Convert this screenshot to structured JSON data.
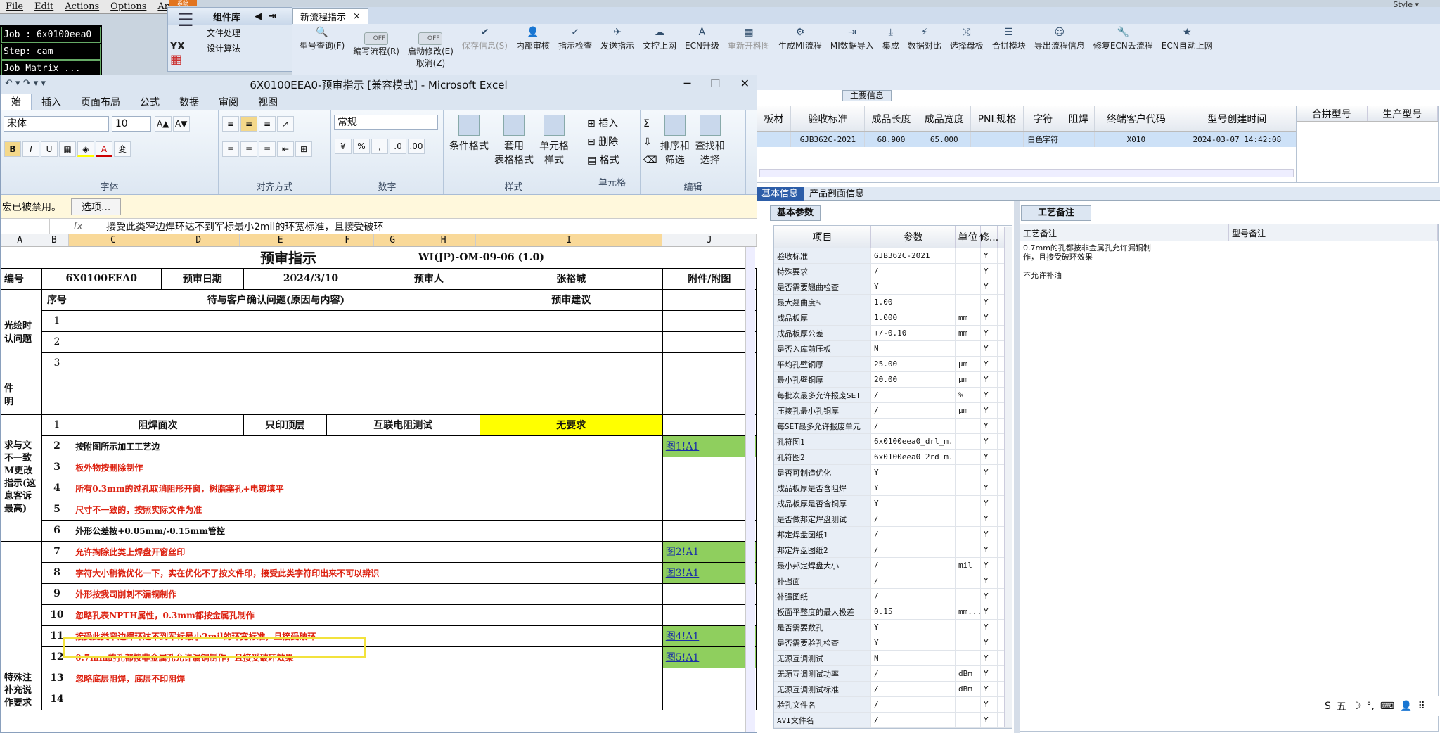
{
  "legacy": {
    "menu": [
      "File",
      "Edit",
      "Actions",
      "Options",
      "Ar"
    ],
    "job": "Job : 6x0100eea0",
    "step": "Step: cam",
    "matrix": "Job Matrix ...",
    "orange": "系统"
  },
  "style_label": "Style ▾",
  "complib": {
    "title": "组件库",
    "items": [
      "文件处理",
      "设计算法"
    ],
    "logo": "YX"
  },
  "ribbon": {
    "tab": "新流程指示",
    "tools": [
      {
        "label": "型号查询(F)",
        "icon": "🔍",
        "dis": false
      },
      {
        "label": "编写流程(R)",
        "icon": "OFF",
        "dis": false,
        "toggle": true
      },
      {
        "label": "启动修改(E)",
        "icon": "OFF",
        "dis": false,
        "toggle": true
      },
      {
        "label": "保存信息(S)",
        "icon": "✔",
        "dis": true
      },
      {
        "label": "内部审核",
        "icon": "👤",
        "dis": false
      },
      {
        "label": "指示检查",
        "icon": "✓",
        "dis": false
      },
      {
        "label": "发送指示",
        "icon": "✈",
        "dis": false
      },
      {
        "label": "文控上网",
        "icon": "☁",
        "dis": false
      },
      {
        "label": "ECN升级",
        "icon": "A",
        "dis": false
      },
      {
        "label": "重新开料图",
        "icon": "▦",
        "dis": true
      },
      {
        "label": "生成MI流程",
        "icon": "⚙",
        "dis": false
      },
      {
        "label": "MI数据导入",
        "icon": "⇥",
        "dis": false
      },
      {
        "label": "集成",
        "icon": "⤓",
        "dis": false
      },
      {
        "label": "数据对比",
        "icon": "⚡",
        "dis": false
      },
      {
        "label": "选择母板",
        "icon": "⤮",
        "dis": false
      },
      {
        "label": "合拼模块",
        "icon": "☰",
        "dis": false
      },
      {
        "label": "导出流程信息",
        "icon": "☺",
        "dis": false
      },
      {
        "label": "修复ECN丢流程",
        "icon": "🔧",
        "dis": false
      },
      {
        "label": "ECN自动上网",
        "icon": "★",
        "dis": false
      }
    ],
    "sub": "取消(Z)"
  },
  "main_info": "主要信息",
  "main_grid": {
    "headers": [
      "板材",
      "验收标准",
      "成品长度",
      "成品宽度",
      "PNL规格",
      "字符",
      "阻焊",
      "终端客户代码",
      "型号创建时间"
    ],
    "row": [
      "",
      "GJB362C-2021",
      "68.900",
      "65.000",
      "",
      "白色字符",
      "",
      "X010",
      "2024-03-07 14:42:08"
    ]
  },
  "grid2_headers": [
    "合拼型号",
    "生产型号"
  ],
  "info_tabs": [
    "基本信息",
    "产品剖面信息"
  ],
  "basic_tab": "基本参数",
  "craft_tab": "工艺备注",
  "param_headers": [
    "项目",
    "参数",
    "单位",
    "修..."
  ],
  "params": [
    [
      "验收标准",
      "GJB362C-2021",
      "",
      "Y"
    ],
    [
      "特殊要求",
      "/",
      "",
      "Y"
    ],
    [
      "是否需要翘曲检查",
      "Y",
      "",
      "Y"
    ],
    [
      "最大翘曲度%",
      "1.00",
      "",
      "Y"
    ],
    [
      "成品板厚",
      "1.000",
      "mm",
      "Y"
    ],
    [
      "成品板厚公差",
      "+/-0.10",
      "mm",
      "Y"
    ],
    [
      "是否入库前压板",
      "N",
      "",
      "Y"
    ],
    [
      "平均孔壁铜厚",
      "25.00",
      "μm",
      "Y"
    ],
    [
      "最小孔壁铜厚",
      "20.00",
      "μm",
      "Y"
    ],
    [
      "每批次最多允许报废SET",
      "/",
      "%",
      "Y"
    ],
    [
      "压接孔最小孔铜厚",
      "/",
      "μm",
      "Y"
    ],
    [
      "每SET最多允许报废单元",
      "/",
      "",
      "Y"
    ],
    [
      "孔符图1",
      "6x0100eea0_drl_m...",
      "",
      "Y"
    ],
    [
      "孔符图2",
      "6x0100eea0_2rd_m...",
      "",
      "Y"
    ],
    [
      "是否可制造优化",
      "Y",
      "",
      "Y"
    ],
    [
      "成品板厚是否含阻焊",
      "Y",
      "",
      "Y"
    ],
    [
      "成品板厚是否含铜厚",
      "Y",
      "",
      "Y"
    ],
    [
      "是否做邦定焊盘测试",
      "/",
      "",
      "Y"
    ],
    [
      "邦定焊盘图纸1",
      "/",
      "",
      "Y"
    ],
    [
      "邦定焊盘图纸2",
      "/",
      "",
      "Y"
    ],
    [
      "最小邦定焊盘大小",
      "/",
      "mil",
      "Y"
    ],
    [
      "补强面",
      "/",
      "",
      "Y"
    ],
    [
      "补强图纸",
      "/",
      "",
      "Y"
    ],
    [
      "板面平整度的最大极差",
      "0.15",
      "mm...",
      "Y"
    ],
    [
      "是否需要数孔",
      "Y",
      "",
      "Y"
    ],
    [
      "是否需要验孔检查",
      "Y",
      "",
      "Y"
    ],
    [
      "无源互调测试",
      "N",
      "",
      "Y"
    ],
    [
      "无源互调测试功率",
      "/",
      "dBm",
      "Y"
    ],
    [
      "无源互调测试标准",
      "/",
      "dBm",
      "Y"
    ],
    [
      "验孔文件名",
      "/",
      "",
      "Y"
    ],
    [
      "AVI文件名",
      "/",
      "",
      "Y"
    ]
  ],
  "craft_headers": [
    "工艺备注",
    "型号备注"
  ],
  "craft_note": [
    "0.7mm的孔都按非金属孔允许漏铜制作，且接受破环效果",
    "",
    "不允许补油"
  ],
  "excel": {
    "title": "6X0100EEA0-预审指示  [兼容模式] - Microsoft Excel",
    "tabs": [
      "始",
      "插入",
      "页面布局",
      "公式",
      "数据",
      "审阅",
      "视图"
    ],
    "font": "宋体",
    "size": "10",
    "numfmt": "常规",
    "groups": [
      "字体",
      "对齐方式",
      "数字",
      "样式",
      "单元格",
      "编辑"
    ],
    "style_btns": [
      "条件格式",
      "套用\n表格格式",
      "单元格\n样式"
    ],
    "cell_btns": [
      "插入",
      "删除",
      "格式"
    ],
    "edit_btns": [
      "排序和\n筛选",
      "查找和\n选择"
    ],
    "macro_msg": "宏已被禁用。",
    "macro_btn": "选项...",
    "formula": "接受此类窄边焊环达不到军标最小2mil的环宽标准，且接受破环",
    "cols": [
      "A",
      "B",
      "C",
      "D",
      "E",
      "F",
      "G",
      "H",
      "I",
      "J"
    ]
  },
  "sheet": {
    "title": "预审指示",
    "docno": "WI(JP)-OM-09-06 (1.0)",
    "r_code_label": "编号",
    "r_code": "6X0100EEA0",
    "r_date_label": "预审日期",
    "r_date": "2024/3/10",
    "r_person_label": "预审人",
    "r_person": "张裕城",
    "r_attach": "附件/附图",
    "h_seq": "序号",
    "h_issue": "待与客户确认问题(原因与内容)",
    "h_sugg": "预审建议",
    "grp1": "光绘时\n认问题",
    "grp2": "件\n明",
    "grp3": "求与文\n不一致\nM更改\n指示(这\n息客诉\n最高)",
    "grp4": "特殊注\n补充说\n作要求",
    "row1": [
      "阻焊面次",
      "只印顶层",
      "互联电阻测试",
      "无要求"
    ],
    "items": [
      {
        "n": "2",
        "t": "按附图所示加工工艺边",
        "red": false,
        "a": "图1!A1"
      },
      {
        "n": "3",
        "t": "板外物按删除制作",
        "red": true,
        "a": ""
      },
      {
        "n": "4",
        "t": "所有0.3mm的过孔取消阻形开窗，树脂塞孔+电镀填平",
        "red": true,
        "a": ""
      },
      {
        "n": "5",
        "t": "尺寸不一致的，按照实际文件为准",
        "red": true,
        "a": ""
      },
      {
        "n": "6",
        "t": "外形公差按+0.05mm/-0.15mm管控",
        "red": false,
        "a": ""
      },
      {
        "n": "7",
        "t": "允许掏除此类上焊盘开窗丝印",
        "red": true,
        "a": "图2!A1"
      },
      {
        "n": "8",
        "t": "字符大小稍微优化一下，实在优化不了按文件印，接受此类字符印出来不可以辨识",
        "red": true,
        "a": "图3!A1"
      },
      {
        "n": "9",
        "t": "外形按我司削刺不漏铜制作",
        "red": true,
        "a": ""
      },
      {
        "n": "10",
        "t": "忽略孔表NPTH属性，0.3mm都按金属孔制作",
        "red": true,
        "a": ""
      },
      {
        "n": "11",
        "t": "接受此类窄边焊环达不到军标最小2mil的环宽标准，且接受破环",
        "red": true,
        "a": "图4!A1"
      },
      {
        "n": "12",
        "t": "0.7mm的孔都按非金属孔允许漏铜制作，且接受破环效果",
        "red": true,
        "a": "图5!A1"
      },
      {
        "n": "13",
        "t": "忽略底层阻焊，底层不印阻焊",
        "red": true,
        "a": ""
      },
      {
        "n": "14",
        "t": "",
        "red": false,
        "a": ""
      }
    ]
  },
  "tray": [
    "S",
    "五",
    "☽",
    "°,",
    "⌨",
    "👤",
    "⠿"
  ]
}
